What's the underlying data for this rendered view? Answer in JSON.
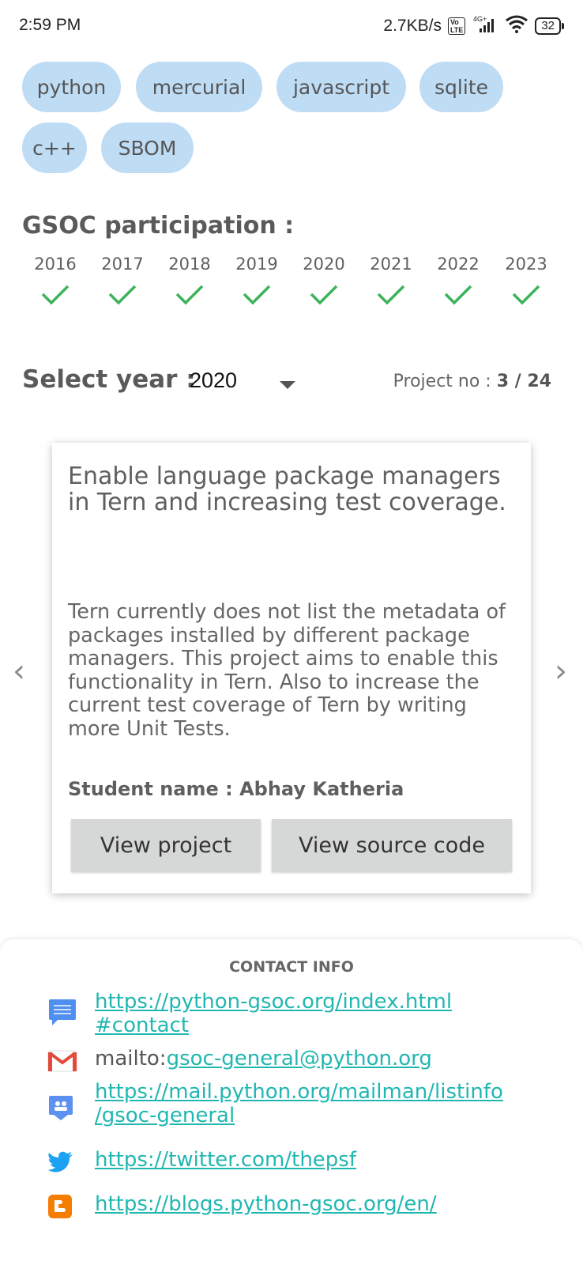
{
  "status_bar": {
    "time": "2:59 PM",
    "speed": "2.7KB/s",
    "network": "4G+",
    "battery": "32"
  },
  "chips": [
    "python",
    "mercurial",
    "javascript",
    "sqlite",
    "c++",
    "SBOM"
  ],
  "gsoc": {
    "title": "GSOC participation :",
    "years": [
      "2016",
      "2017",
      "2018",
      "2019",
      "2020",
      "2021",
      "2022",
      "2023"
    ]
  },
  "select": {
    "label": "Select year :",
    "value": "2020",
    "project_label": "Project no : ",
    "project_value": "3 / 24"
  },
  "card": {
    "title": "Enable language package managers in Tern and increasing test coverage.",
    "description": "Tern currently does not list the metadata of packages installed by different package managers. This project aims to enable this functionality in Tern. Also to increase the current test coverage of Tern by writing more Unit Tests.",
    "student": "Student name : Abhay Katheria",
    "view_project": "View project",
    "view_source": "View source code",
    "prev": "‹",
    "next": "›"
  },
  "contact": {
    "title": "CONTACT INFO",
    "website_line1": "https://python-gsoc.org/index.html",
    "website_line2": "#contact",
    "mail_prefix": "mailto:",
    "mail": "gsoc-general@python.org",
    "list_line1": "https://mail.python.org/mailman/listinfo",
    "list_line2": "/gsoc-general",
    "twitter": "https://twitter.com/thepsf",
    "blog": "https://blogs.python-gsoc.org/en/"
  },
  "colors": {
    "chip": "#bfdcf5",
    "check": "#3cb35a",
    "link": "#21b7b1"
  }
}
